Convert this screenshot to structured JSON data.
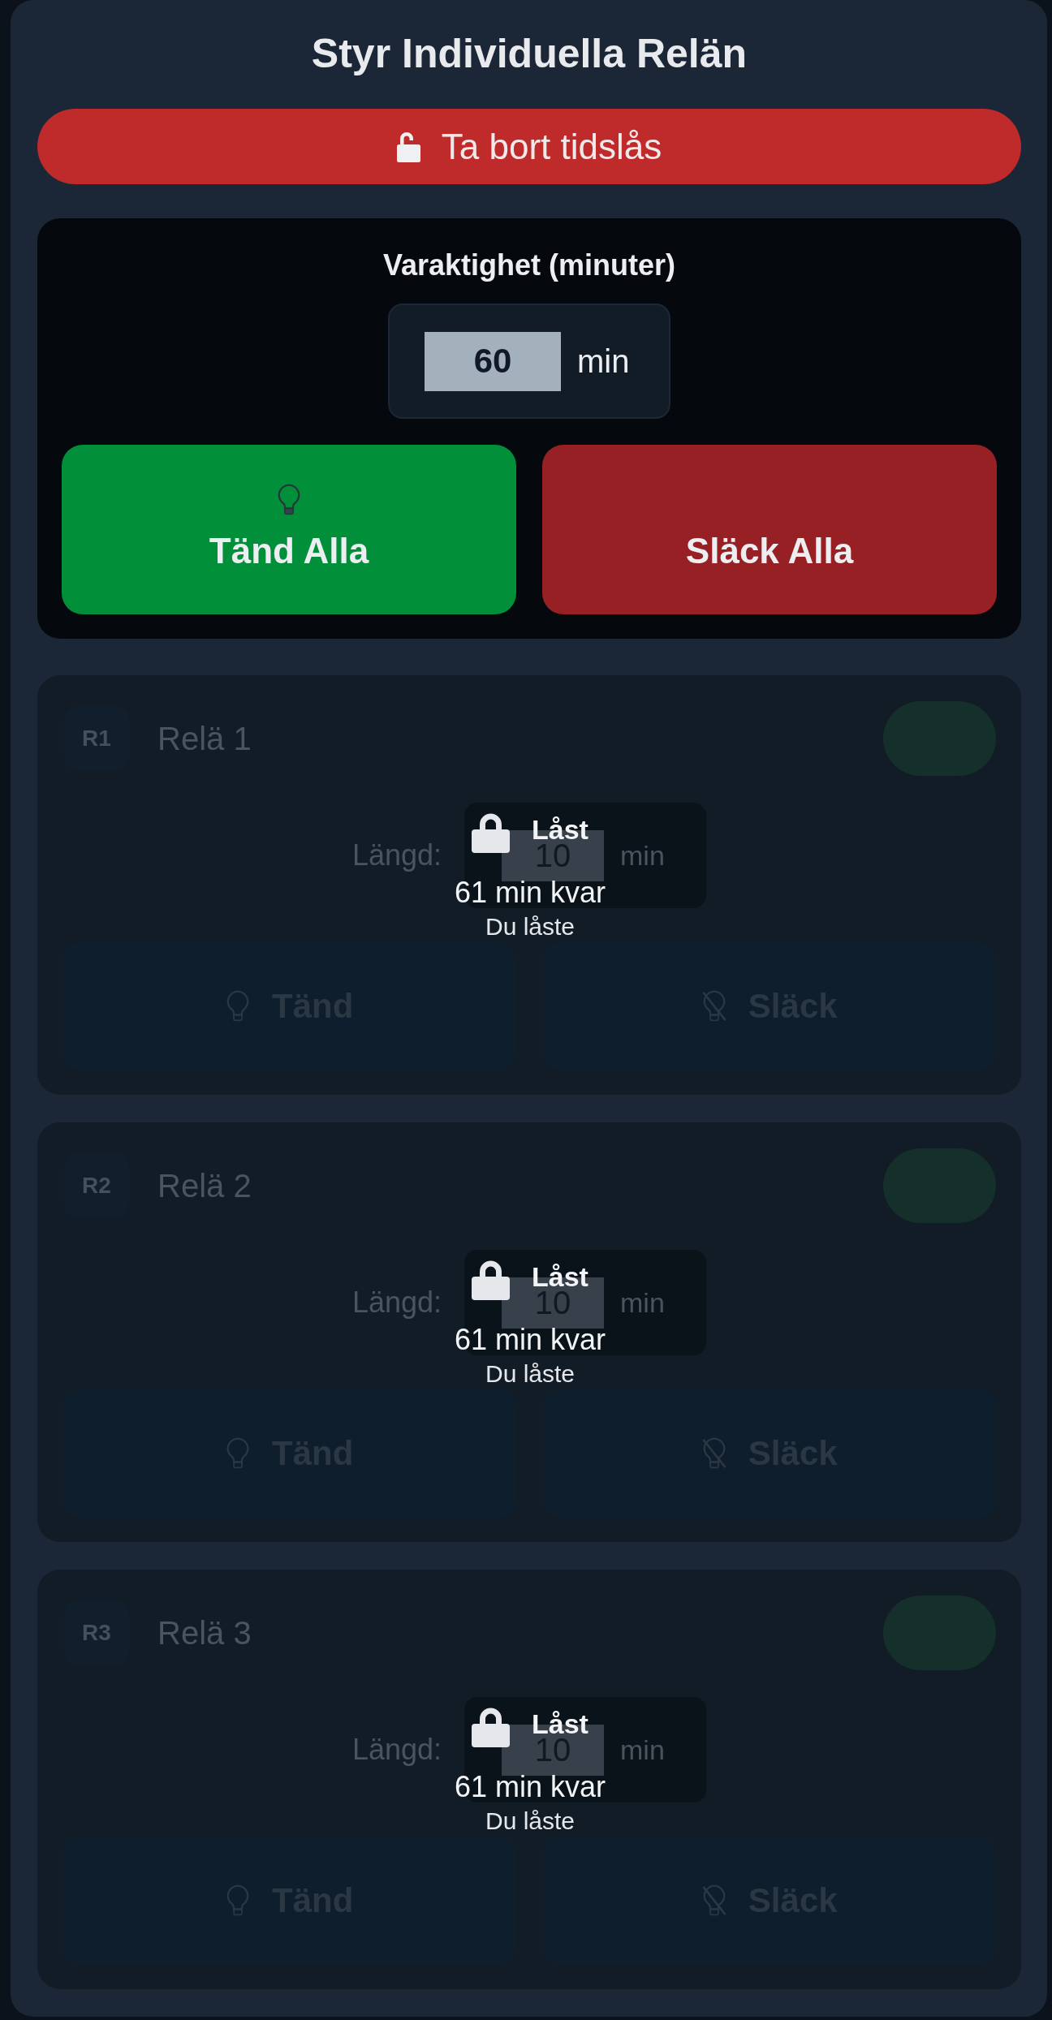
{
  "title": "Styr Individuella Relän",
  "unlock_button": {
    "label": "Ta bort tidslås"
  },
  "duration": {
    "label": "Varaktighet (minuter)",
    "value": "60",
    "unit": "min"
  },
  "all_buttons": [
    {
      "label": "Tänd Alla",
      "kind": "on"
    },
    {
      "label": "Släck Alla",
      "kind": "off"
    }
  ],
  "relays": [
    {
      "badge": "R1",
      "name": "Relä 1",
      "on": true,
      "length_label": "Längd:",
      "length_value": "10",
      "length_unit": "min",
      "locked": true,
      "lock_label": "Låst",
      "remaining": "61 min kvar",
      "locked_by": "Du låste",
      "buttons": [
        {
          "label": "Tänd",
          "kind": "on"
        },
        {
          "label": "Släck",
          "kind": "off"
        }
      ]
    },
    {
      "badge": "R2",
      "name": "Relä 2",
      "on": true,
      "length_label": "Längd:",
      "length_value": "10",
      "length_unit": "min",
      "locked": true,
      "lock_label": "Låst",
      "remaining": "61 min kvar",
      "locked_by": "Du låste",
      "buttons": [
        {
          "label": "Tänd",
          "kind": "on"
        },
        {
          "label": "Släck",
          "kind": "off"
        }
      ]
    },
    {
      "badge": "R3",
      "name": "Relä 3",
      "on": true,
      "length_label": "Längd:",
      "length_value": "10",
      "length_unit": "min",
      "locked": true,
      "lock_label": "Låst",
      "remaining": "61 min kvar",
      "locked_by": "Du låste",
      "buttons": [
        {
          "label": "Tänd",
          "kind": "on"
        },
        {
          "label": "Släck",
          "kind": "off"
        }
      ]
    }
  ]
}
